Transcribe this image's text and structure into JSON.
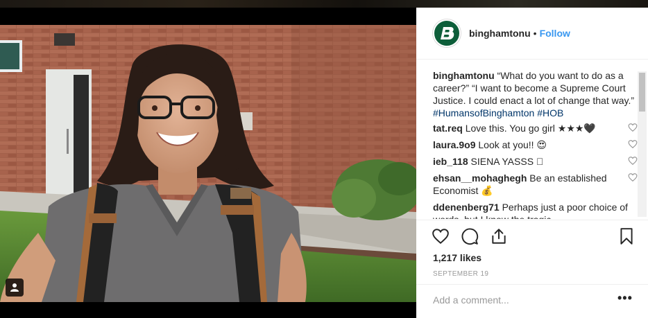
{
  "post": {
    "username": "binghamtonu",
    "separator": "•",
    "follow_label": "Follow",
    "avatar_letter": "B",
    "likes": "1,217 likes",
    "date": "September 19",
    "add_comment_placeholder": "Add a comment...",
    "more_label": "•••"
  },
  "caption": {
    "username": "binghamtonu",
    "text": "“What do you want to do as a career?” “I want to become a Supreme Court Justice. I could enact a lot of change that way.” ",
    "hashtag1": "#HumansofBinghamton",
    "space": " ",
    "hashtag2": "#HOB"
  },
  "comments": [
    {
      "username": "tat.req",
      "text": "Love this. You go girl ★★★🖤"
    },
    {
      "username": "laura.9o9",
      "text": "Look at you!! 😍"
    },
    {
      "username": "ieb_118",
      "text": "SIENA YASSS ⃞"
    },
    {
      "username": "ehsan__mohaghegh",
      "text": "Be an established Economist 💰"
    },
    {
      "username": "ddenenberg71",
      "text": "Perhaps just a poor choice of words, but I know the tragic"
    }
  ],
  "colors": {
    "accent": "#3897f0",
    "hashtag": "#003569",
    "avatar_bg": "#0d5e3a"
  },
  "icons": [
    "heart-icon",
    "comment-icon",
    "share-icon",
    "bookmark-icon",
    "user-tag-icon"
  ]
}
